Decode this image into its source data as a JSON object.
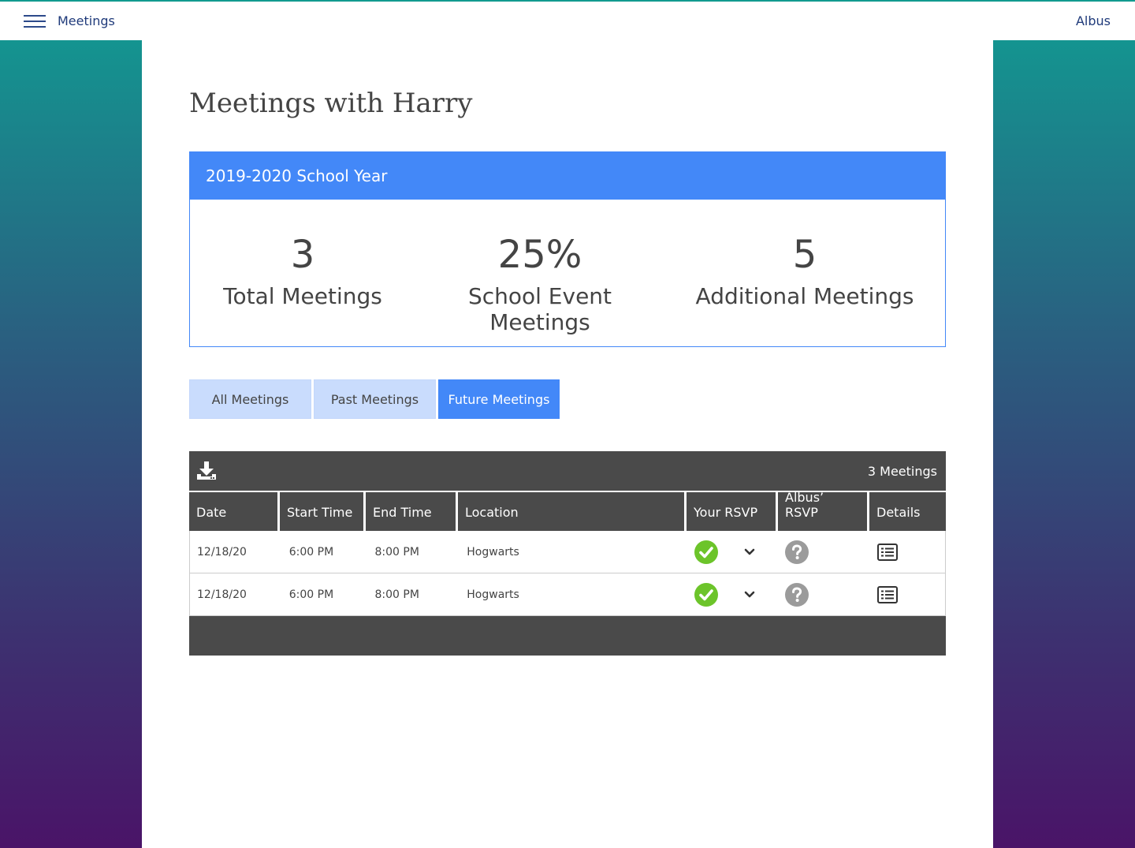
{
  "nav": {
    "title": "Meetings",
    "user": "Albus"
  },
  "page": {
    "title": "Meetings with Harry"
  },
  "summary": {
    "header": "2019-2020 School Year",
    "stats": [
      {
        "value": "3",
        "label": "Total Meetings"
      },
      {
        "value": "25%",
        "label": "School Event Meetings"
      },
      {
        "value": "5",
        "label": "Additional Meetings"
      }
    ]
  },
  "tabs": [
    {
      "label": "All Meetings",
      "active": false
    },
    {
      "label": "Past Meetings",
      "active": false
    },
    {
      "label": "Future Meetings",
      "active": true
    }
  ],
  "table": {
    "count_label": "3 Meetings",
    "columns": [
      "Date",
      "Start Time",
      "End Time",
      "Location",
      "Your RSVP",
      "Albus’ RSVP",
      "Details"
    ],
    "rows": [
      {
        "date": "12/18/20",
        "start": "6:00 PM",
        "end": "8:00 PM",
        "location": "Hogwarts",
        "your_rsvp": "accepted",
        "other_rsvp": "unknown"
      },
      {
        "date": "12/18/20",
        "start": "6:00 PM",
        "end": "8:00 PM",
        "location": "Hogwarts",
        "your_rsvp": "accepted",
        "other_rsvp": "unknown"
      }
    ]
  },
  "colors": {
    "accent": "#4388f8",
    "tab_inactive": "#c9dcfd",
    "table_dark": "#4a4a4a",
    "check_green": "#6cc42a",
    "question_gray": "#9b9b9b"
  },
  "icons": {
    "menu": "hamburger-icon",
    "download": "download-icon",
    "rsvp_accepted": "check-circle-icon",
    "rsvp_dropdown": "chevron-down-icon",
    "rsvp_unknown": "question-circle-icon",
    "details": "list-icon"
  }
}
